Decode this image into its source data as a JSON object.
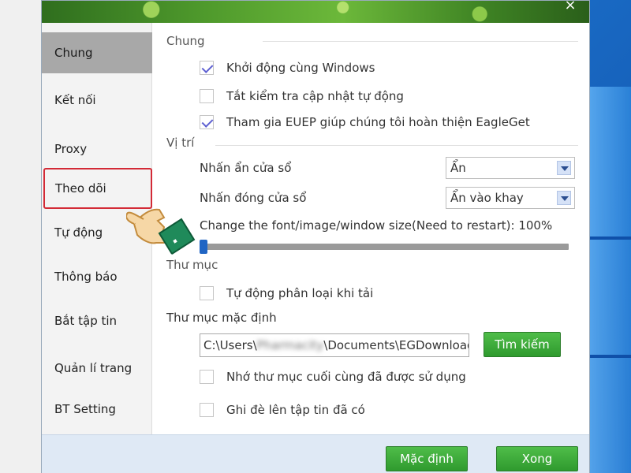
{
  "window": {
    "close_label": "×"
  },
  "sidebar": {
    "items": [
      {
        "label": "Chung"
      },
      {
        "label": "Kết nối"
      },
      {
        "label": "Proxy"
      },
      {
        "label": "Theo dõi"
      },
      {
        "label": "Tự động"
      },
      {
        "label": "Thông báo"
      },
      {
        "label": "Bắt tập tin"
      },
      {
        "label": "Quản lí trang"
      },
      {
        "label": "BT Setting"
      }
    ],
    "active_index": 0,
    "highlighted_index": 3
  },
  "general": {
    "title": "Chung",
    "start_with_windows": {
      "label": "Khởi động cùng Windows",
      "checked": true
    },
    "disable_auto_update": {
      "label": "Tắt kiểm tra cập nhật tự động",
      "checked": false
    },
    "join_euep": {
      "label": "Tham gia EUEP giúp chúng tôi hoàn thiện EagleGet",
      "checked": true
    }
  },
  "position": {
    "title": "Vị trí",
    "hide_window": {
      "label": "Nhấn ẩn cửa sổ",
      "value": "Ẩn"
    },
    "close_window": {
      "label": "Nhấn đóng cửa sổ",
      "value": "Ẩn vào khay"
    },
    "size_label": "Change the font/image/window size(Need to restart): 100%",
    "size_slider_fraction": 0.0
  },
  "folder": {
    "title": "Thư mục",
    "auto_classify": {
      "label": "Tự động phân loại khi tải",
      "checked": false
    },
    "default_label": "Thư mục mặc định",
    "path_prefix": "C:\\Users\\",
    "path_masked": "Pharmacity",
    "path_suffix": "\\Documents\\EGDownload",
    "search_button": "Tìm kiếm",
    "remember_last": {
      "label": "Nhớ thư mục cuối cùng đã được sử dụng",
      "checked": false
    },
    "overwrite": {
      "label": "Ghi đè lên tập tin đã có",
      "checked": false
    }
  },
  "footer": {
    "default_button": "Mặc định",
    "done_button": "Xong"
  },
  "colors": {
    "active_sidebar": "#a8a8a8",
    "highlight_border": "#d32a36",
    "check_color": "#5d5fd1",
    "button_green": "#3aa83a",
    "slider_thumb": "#2065c4",
    "desktop_blue": "#1b6ec8"
  },
  "icons": {
    "pointer": "pointing-hand-icon",
    "close": "close-icon",
    "dropdown": "chevron-down-icon"
  }
}
